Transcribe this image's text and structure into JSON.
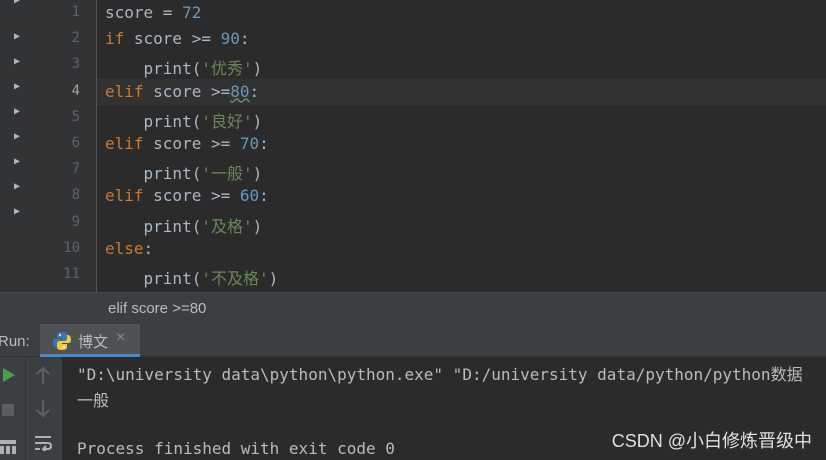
{
  "editor": {
    "line_numbers": [
      "1",
      "2",
      "3",
      "4",
      "5",
      "6",
      "7",
      "8",
      "9",
      "10",
      "11"
    ],
    "current_line": "4",
    "lines": [
      [
        {
          "t": "score = ",
          "c": "plain"
        },
        {
          "t": "72",
          "c": "num"
        }
      ],
      [
        {
          "t": "if",
          "c": "kw"
        },
        {
          "t": " score >= ",
          "c": "plain"
        },
        {
          "t": "90",
          "c": "num"
        },
        {
          "t": ":",
          "c": "plain"
        }
      ],
      [
        {
          "t": "    print(",
          "c": "plain"
        },
        {
          "t": "'优秀'",
          "c": "str"
        },
        {
          "t": ")",
          "c": "plain"
        }
      ],
      [
        {
          "t": "elif",
          "c": "kw"
        },
        {
          "t": " score >=",
          "c": "plain"
        },
        {
          "t": "80",
          "c": "num under"
        },
        {
          "t": ":",
          "c": "plain"
        }
      ],
      [
        {
          "t": "    print(",
          "c": "plain"
        },
        {
          "t": "'良好'",
          "c": "str"
        },
        {
          "t": ")",
          "c": "plain"
        }
      ],
      [
        {
          "t": "elif",
          "c": "kw"
        },
        {
          "t": " score >= ",
          "c": "plain"
        },
        {
          "t": "70",
          "c": "num"
        },
        {
          "t": ":",
          "c": "plain"
        }
      ],
      [
        {
          "t": "    print(",
          "c": "plain"
        },
        {
          "t": "'一般'",
          "c": "str"
        },
        {
          "t": ")",
          "c": "plain"
        }
      ],
      [
        {
          "t": "elif",
          "c": "kw"
        },
        {
          "t": " score >= ",
          "c": "plain"
        },
        {
          "t": "60",
          "c": "num"
        },
        {
          "t": ":",
          "c": "plain"
        }
      ],
      [
        {
          "t": "    print(",
          "c": "plain"
        },
        {
          "t": "'及格'",
          "c": "str"
        },
        {
          "t": ")",
          "c": "plain"
        }
      ],
      [
        {
          "t": "else",
          "c": "kw"
        },
        {
          "t": ":",
          "c": "plain"
        }
      ],
      [
        {
          "t": "    print(",
          "c": "plain"
        },
        {
          "t": "'不及格'",
          "c": "str"
        },
        {
          "t": ")",
          "c": "plain"
        }
      ]
    ],
    "fold_icon": "triangle-right-icon"
  },
  "breadcrumb": {
    "text": "elif score >=80"
  },
  "run": {
    "label": "Run:",
    "tab_label": "博文",
    "tab_icon": "python-icon",
    "tab_close": "×",
    "tools": [
      "play-icon",
      "stop-icon",
      "arrow-up-icon",
      "arrow-down-icon",
      "layout-icon",
      "soft-wrap-icon"
    ]
  },
  "console": {
    "lines": [
      "\"D:\\university data\\python\\python.exe\" \"D:/university data/python/python数据",
      "一般",
      "",
      "Process finished with exit code 0"
    ]
  },
  "watermark": "CSDN @小白修炼晋级中",
  "colors": {
    "keyword": "#cc7832",
    "number": "#6897bb",
    "string": "#6a8759",
    "accent": "#4a88c7"
  }
}
